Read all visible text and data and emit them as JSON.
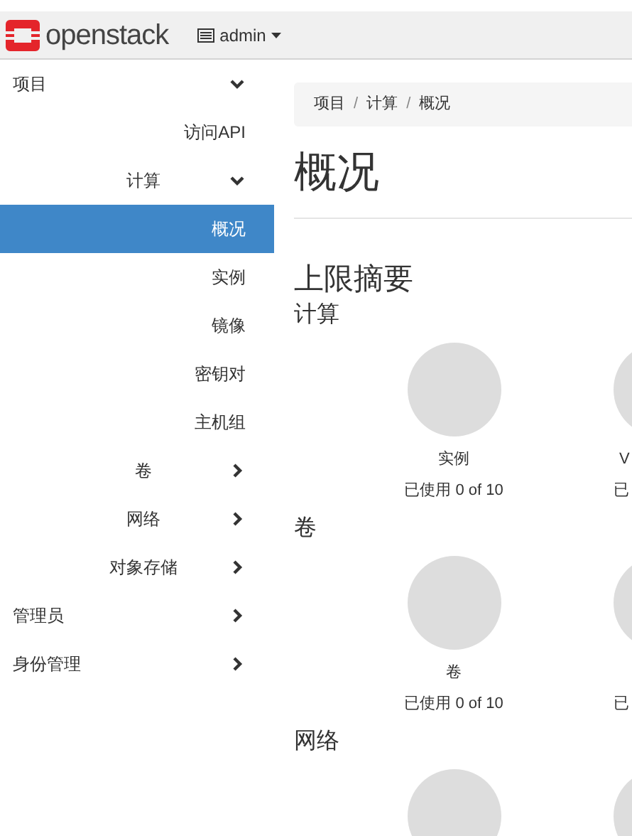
{
  "topbar": {
    "logo": "openstack",
    "project_menu": "admin"
  },
  "sidebar": {
    "items": [
      {
        "label": "项目",
        "kind": "group",
        "expanded": true,
        "children": [
          {
            "label": "访问API",
            "kind": "link",
            "selected": false
          },
          {
            "label": "计算",
            "kind": "subgroup",
            "expanded": true,
            "children": [
              {
                "label": "概况",
                "kind": "link",
                "selected": true
              },
              {
                "label": "实例",
                "kind": "link",
                "selected": false
              },
              {
                "label": "镜像",
                "kind": "link",
                "selected": false
              },
              {
                "label": "密钥对",
                "kind": "link",
                "selected": false
              },
              {
                "label": "主机组",
                "kind": "link",
                "selected": false
              }
            ]
          },
          {
            "label": "卷",
            "kind": "subgroup",
            "expanded": false
          },
          {
            "label": "网络",
            "kind": "subgroup",
            "expanded": false
          },
          {
            "label": "对象存储",
            "kind": "subgroup",
            "expanded": false
          }
        ]
      },
      {
        "label": "管理员",
        "kind": "group",
        "expanded": false
      },
      {
        "label": "身份管理",
        "kind": "group",
        "expanded": false
      }
    ]
  },
  "breadcrumb": {
    "separator": "/",
    "items": [
      "项目",
      "计算",
      "概况"
    ]
  },
  "page_title": "概况",
  "limit_summary": {
    "title": "上限摘要",
    "sections": [
      {
        "title": "计算",
        "quotas": [
          {
            "kind": "quota",
            "label": "实例",
            "usage": "已使用 0 of 10"
          },
          {
            "kind": "quota",
            "label": "V",
            "usage": "已"
          }
        ]
      },
      {
        "title": "卷",
        "quotas": [
          {
            "kind": "quota",
            "label": "卷",
            "usage": "已使用 0 of 10"
          },
          {
            "kind": "quota",
            "usage": "已"
          }
        ]
      },
      {
        "title": "网络",
        "quotas": [
          {
            "kind": "chart_only"
          },
          {
            "kind": "chart_only"
          }
        ]
      }
    ]
  }
}
